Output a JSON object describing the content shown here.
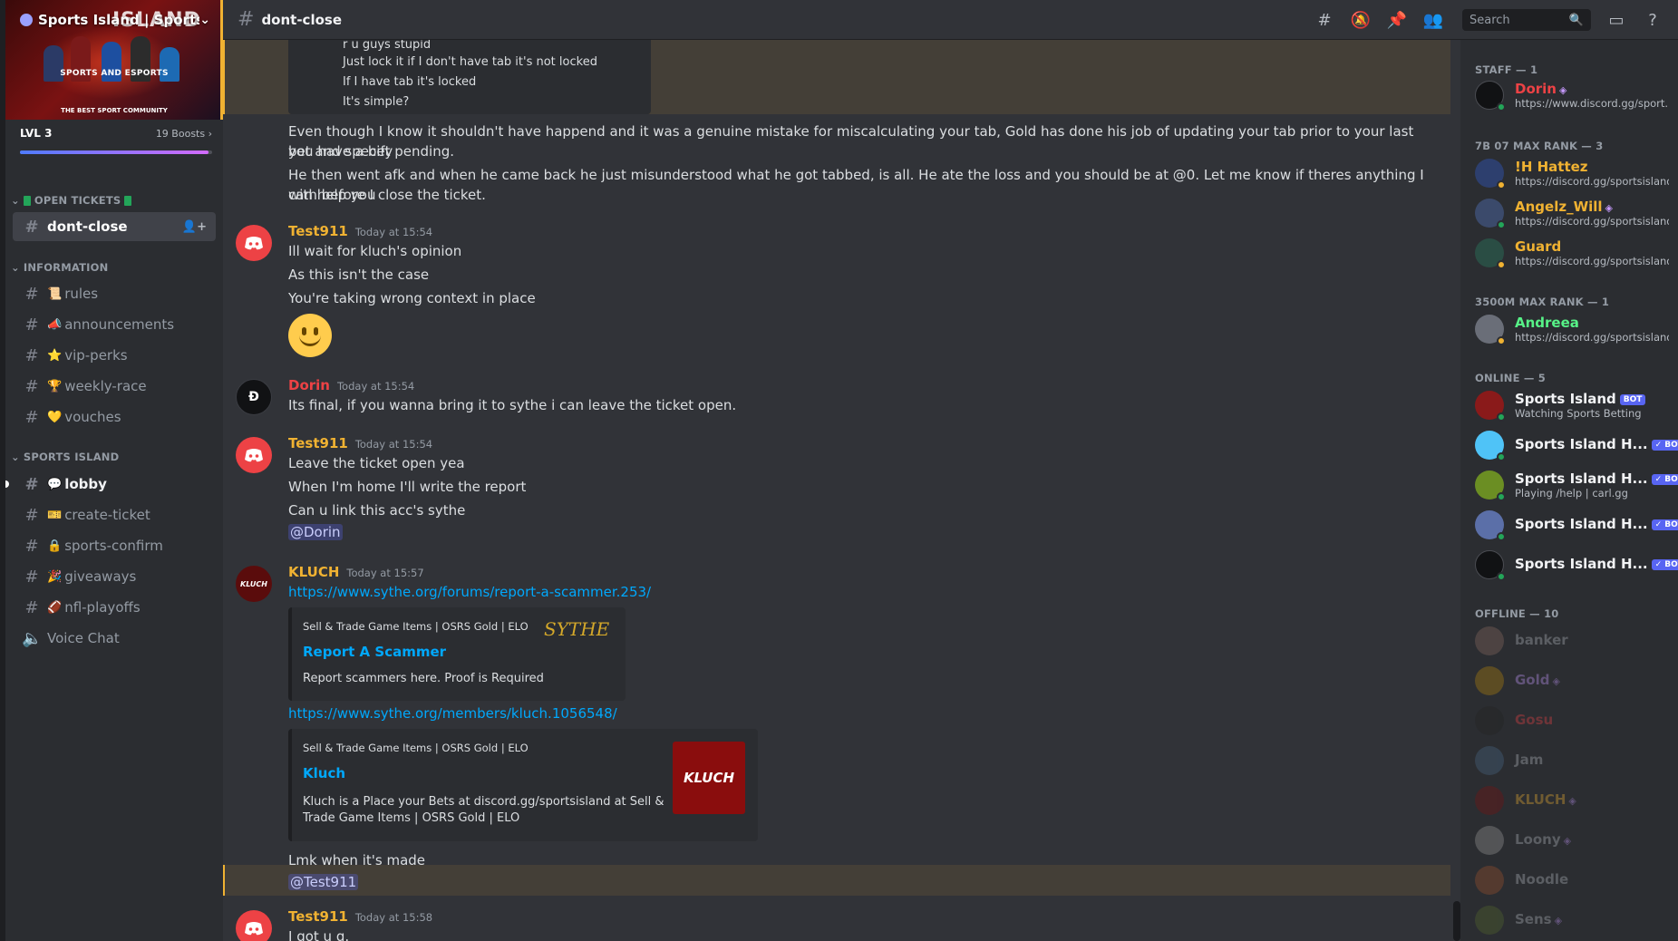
{
  "server": {
    "name": "Sports Island | Sports",
    "banner_big": "ISLAND",
    "banner_title": "SPORTS AND ESPORTS",
    "banner_sub": "THE BEST SPORT COMMUNITY",
    "level": "LVL 3",
    "boosts": "19 Boosts",
    "boost_progress": 0.98
  },
  "sidebar": {
    "categories": [
      {
        "label": "OPEN TICKETS"
      },
      {
        "label": "INFORMATION"
      },
      {
        "label": "SPORTS ISLAND"
      }
    ],
    "channels": [
      {
        "label": "dont-close",
        "emoji": ""
      },
      {
        "label": "rules",
        "emoji": "📜"
      },
      {
        "label": "announcements",
        "emoji": "📣"
      },
      {
        "label": "vip-perks",
        "emoji": "⭐"
      },
      {
        "label": "weekly-race",
        "emoji": "🏆"
      },
      {
        "label": "vouches",
        "emoji": "💛"
      },
      {
        "label": "lobby",
        "emoji": "💬"
      },
      {
        "label": "create-ticket",
        "emoji": "🎫"
      },
      {
        "label": "sports-confirm",
        "emoji": "🔒"
      },
      {
        "label": "giveaways",
        "emoji": "🎉"
      },
      {
        "label": "nfl-playoffs",
        "emoji": "🏈"
      },
      {
        "label": "Voice Chat",
        "emoji": ""
      }
    ]
  },
  "header": {
    "channel": "dont-close",
    "search_placeholder": "Search",
    "icons": [
      "threads-icon",
      "mute-icon",
      "pin-icon",
      "members-icon",
      "inbox-icon",
      "help-icon"
    ]
  },
  "chat": {
    "quote_lines": [
      "r u guys stupid",
      "Just lock it if I don't have tab it's not locked",
      "If I have tab it's locked",
      "It's simple?"
    ],
    "cont_lines": [
      "Even though I know it shouldn't have happend and it was a genuine mistake for miscalculating your tab, Gold has done his job of updating your tab prior to your last bet and specify",
      "you have a bet pending.",
      "He then went afk and when he came back he just misunderstood what he got tabbed, is all. He ate the loss and you should be at @0. Let me know if theres anything I can help you",
      "with before I close the ticket."
    ],
    "messages": [
      {
        "author": "Test911",
        "time": "Today at 15:54",
        "color": "#f0b232",
        "lines": [
          "Ill wait for kluch's opinion",
          "As this isn't the case",
          "You're taking wrong context in place"
        ]
      },
      {
        "author": "Dorin",
        "time": "Today at 15:54",
        "color": "#ed4245",
        "lines": [
          "Its final, if you wanna bring it to sythe i can leave the ticket open."
        ]
      },
      {
        "author": "Test911",
        "time": "Today at 15:54",
        "color": "#f0b232",
        "lines": [
          "Leave the ticket open yea",
          "When I'm home I'll write the report",
          "Can u link this acc's sythe"
        ],
        "mention": "@Dorin"
      },
      {
        "author": "KLUCH",
        "time": "Today at 15:57",
        "color": "#f0b232"
      },
      {
        "author": "Test911",
        "time": "Today at 15:58",
        "color": "#f0b232",
        "lines": [
          "I got u g."
        ]
      }
    ],
    "kluch": {
      "link1": "https://www.sythe.org/forums/report-a-scammer.253/",
      "embed1": {
        "provider": "Sell & Trade Game Items | OSRS Gold | ELO",
        "title": "Report A Scammer",
        "desc": "Report scammers here. Proof is Required",
        "thumb": "SYTHE"
      },
      "link2": "https://www.sythe.org/members/kluch.1056548/",
      "embed2": {
        "provider": "Sell & Trade Game Items | OSRS Gold | ELO",
        "title": "Kluch",
        "desc1": "Kluch is a Place your Bets at discord.gg/sportsisland at Sell &",
        "desc2": "Trade Game Items | OSRS Gold | ELO",
        "thumb": "KLUCH"
      },
      "after": "Lmk when it's made",
      "mention": "@Test911"
    }
  },
  "members": {
    "groups": [
      {
        "label": "STAFF — 1"
      },
      {
        "label": "7B 07 MAX RANK — 3"
      },
      {
        "label": "3500M MAX RANK — 1"
      },
      {
        "label": "ONLINE — 5"
      },
      {
        "label": "OFFLINE — 10"
      }
    ],
    "list": [
      {
        "name": "Dorin",
        "sub": "https://www.discord.gg/sport...",
        "color": "#ed4245",
        "gem": "◈"
      },
      {
        "name": "!H Hattez",
        "sub": "https://discord.gg/sportsisland",
        "color": "#f0b232"
      },
      {
        "name": "Angelz_Will",
        "sub": "https://discord.gg/sportsisland",
        "color": "#f0b232",
        "gem": "◈"
      },
      {
        "name": "Guard",
        "sub": "https://discord.gg/sportsisland",
        "color": "#f0b232"
      },
      {
        "name": "Andreea",
        "sub": "https://discord.gg/sportsisland",
        "color": "#57f287"
      },
      {
        "name": "Sports Island",
        "sub": "Watching Sports Betting",
        "color": "#f2f3f5",
        "badge": "BOT"
      },
      {
        "name": "Sports Island H...",
        "color": "#f2f3f5",
        "badge": "✓ BOT"
      },
      {
        "name": "Sports Island H...",
        "sub": "Playing /help | carl.gg",
        "color": "#f2f3f5",
        "badge": "✓ BOT"
      },
      {
        "name": "Sports Island H...",
        "color": "#f2f3f5",
        "badge": "✓ BOT"
      },
      {
        "name": "Sports Island H...",
        "color": "#f2f3f5",
        "badge": "✓ BOT"
      },
      {
        "name": "banker",
        "color": "#b5bac1"
      },
      {
        "name": "Gold",
        "color": "#c79aff",
        "gem": "◈"
      },
      {
        "name": "Gosu",
        "color": "#ed4245"
      },
      {
        "name": "Jam",
        "color": "#b5bac1"
      },
      {
        "name": "KLUCH",
        "color": "#f0b232",
        "gem": "◈"
      },
      {
        "name": "Loony",
        "color": "#b5bac1",
        "gem": "◈"
      },
      {
        "name": "Noodle",
        "color": "#b5bac1"
      },
      {
        "name": "Sens",
        "color": "#b5bac1",
        "gem": "◈"
      }
    ]
  }
}
